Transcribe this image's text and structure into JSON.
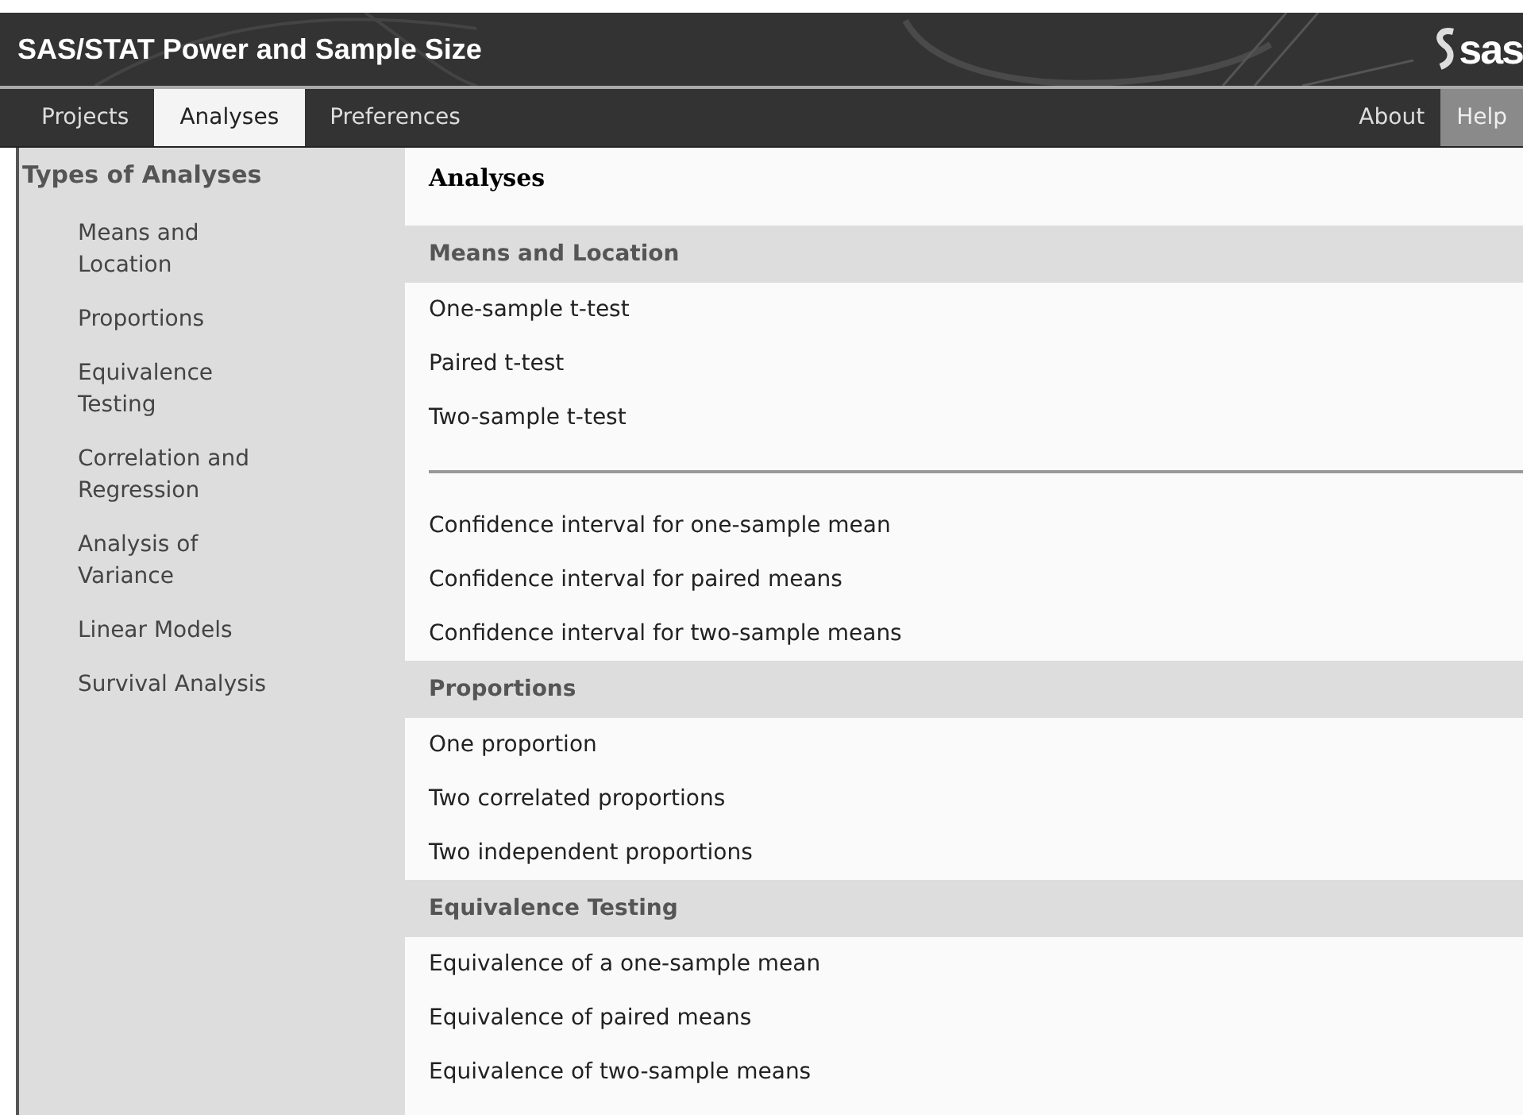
{
  "header": {
    "title": "SAS/STAT Power and Sample Size",
    "logo": "sas"
  },
  "nav": {
    "left": [
      {
        "label": "Projects",
        "selected": false
      },
      {
        "label": "Analyses",
        "selected": true
      },
      {
        "label": "Preferences",
        "selected": false
      }
    ],
    "right": [
      {
        "label": "About",
        "selected": false
      },
      {
        "label": "Help",
        "selected": true
      }
    ]
  },
  "sidebar": {
    "title": "Types of Analyses",
    "items": [
      "Means and Location",
      "Proportions",
      "Equivalence Testing",
      "Correlation and Regression",
      "Analysis of Variance",
      "Linear Models",
      "Survival Analysis"
    ]
  },
  "content": {
    "title": "Analyses",
    "rows": [
      {
        "kind": "section",
        "text": "Means and Location"
      },
      {
        "kind": "item",
        "text": "One-sample t-test"
      },
      {
        "kind": "item",
        "text": "Paired t-test"
      },
      {
        "kind": "item",
        "text": "Two-sample t-test"
      },
      {
        "kind": "divider"
      },
      {
        "kind": "item",
        "text": "Confidence interval for one-sample mean"
      },
      {
        "kind": "item",
        "text": "Confidence interval for paired means"
      },
      {
        "kind": "item",
        "text": "Confidence interval for two-sample means"
      },
      {
        "kind": "section",
        "text": "Proportions"
      },
      {
        "kind": "item",
        "text": "One proportion"
      },
      {
        "kind": "item",
        "text": "Two correlated proportions"
      },
      {
        "kind": "item",
        "text": "Two independent proportions"
      },
      {
        "kind": "section",
        "text": "Equivalence Testing"
      },
      {
        "kind": "item",
        "text": "Equivalence of a one-sample mean"
      },
      {
        "kind": "item",
        "text": "Equivalence of paired means"
      },
      {
        "kind": "item",
        "text": "Equivalence of two-sample means"
      }
    ]
  }
}
